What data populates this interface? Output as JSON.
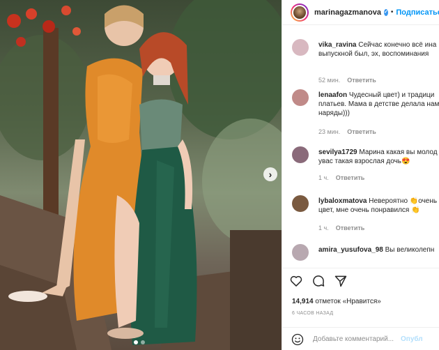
{
  "post": {
    "carousel": {
      "slide_count": 2,
      "active_slide": 1
    }
  },
  "header": {
    "username": "marinagazmanova",
    "separator": "•",
    "follow_label": "Подписаться"
  },
  "comments": [
    {
      "user": "vika_ravina",
      "text_line1": " Сейчас конечно всё ина",
      "text_line2": "выпускной был, эх, воспоминания",
      "emoji": "😍",
      "time": "52 мин.",
      "reply": "Ответить",
      "avatar_color": "#d8b8c0"
    },
    {
      "user": "lenaafon",
      "text_line1": " Чудесный цвет) и традици",
      "text_line2": "платьев. Мама в детстве делала нам",
      "text_line3": "наряды)))",
      "time": "23 мин.",
      "reply": "Ответить",
      "avatar_color": "#c08a88"
    },
    {
      "user": "sevilya1729",
      "text_line1": " Марина какая вы молод",
      "text_line2": "увас такая взрослая дочь",
      "emoji": "😍",
      "time": "1 ч.",
      "reply": "Ответить",
      "avatar_color": "#8a6a7a"
    },
    {
      "user": "lybaloxmatova",
      "text_line1": " Невероятно ",
      "emoji_inline": "👏",
      "text_line1b": "очень",
      "text_line2": "цвет, мне очень понравился",
      "emoji": "👏",
      "time": "1 ч.",
      "reply": "Ответить",
      "avatar_color": "#7a5a40"
    },
    {
      "user": "amira_yusufova_98",
      "text_line1": " Вы великолепн",
      "avatar_color": "#b8a8b0"
    }
  ],
  "actions": {
    "icons": [
      "heart-icon",
      "comment-icon",
      "share-icon"
    ],
    "likes_count": "14,914",
    "likes_label": " отметок «Нравится»",
    "timestamp": "6 ЧАСОВ НАЗАД"
  },
  "add_comment": {
    "placeholder": "Добавьте комментарий...",
    "publish_label": "Опубл"
  },
  "colors": {
    "accent": "#0095f6",
    "verified": "#3897f0",
    "muted": "#8e8e8e",
    "orange_dress": "#e08a2a",
    "green_dress": "#1f5a45"
  }
}
